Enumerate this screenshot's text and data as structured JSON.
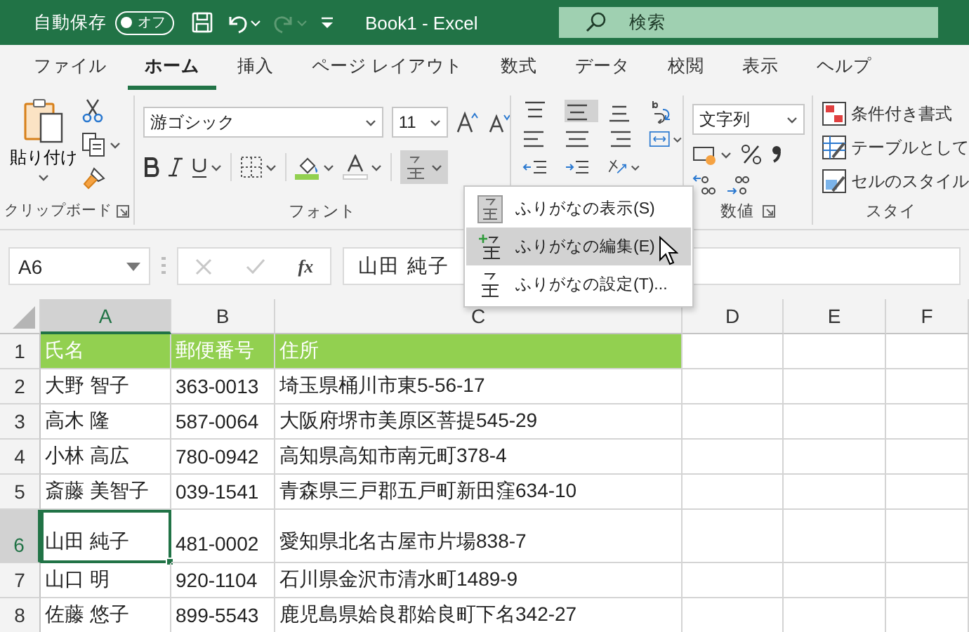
{
  "title_bar": {
    "autosave_label": "自動保存",
    "autosave": {
      "label": "オフ",
      "on": false
    },
    "title": "Book1  -  Excel",
    "search": {
      "placeholder": "検索"
    }
  },
  "ribbon_tabs": [
    {
      "label": "ファイル",
      "selected": false
    },
    {
      "label": "ホーム",
      "selected": true
    },
    {
      "label": "挿入",
      "selected": false
    },
    {
      "label": "ページ レイアウト",
      "selected": false
    },
    {
      "label": "数式",
      "selected": false
    },
    {
      "label": "データ",
      "selected": false
    },
    {
      "label": "校閲",
      "selected": false
    },
    {
      "label": "表示",
      "selected": false
    },
    {
      "label": "ヘルプ",
      "selected": false
    }
  ],
  "ribbon": {
    "clipboard": {
      "label": "クリップボード",
      "paste_label": "貼り付け"
    },
    "font": {
      "label": "フォント",
      "font_name": "游ゴシック",
      "font_size": "11"
    },
    "number": {
      "label": "数値",
      "format": "文字列"
    },
    "styles": {
      "label": "スタイ",
      "items": [
        "条件付き書式",
        "テーブルとして",
        "セルのスタイル"
      ]
    }
  },
  "furigana_menu": {
    "items": [
      {
        "label": "ふりがなの表示(S)",
        "selected": false
      },
      {
        "label": "ふりがなの編集(E)",
        "selected": true
      },
      {
        "label": "ふりがなの設定(T)...",
        "selected": false
      }
    ]
  },
  "formula_bar": {
    "name_box": "A6",
    "fx_label": "fx",
    "formula": "山田 純子"
  },
  "grid": {
    "columns": [
      {
        "label": "A",
        "selected": true
      },
      {
        "label": "B",
        "selected": false
      },
      {
        "label": "C",
        "selected": false
      },
      {
        "label": "D",
        "selected": false
      },
      {
        "label": "E",
        "selected": false
      },
      {
        "label": "F",
        "selected": false
      }
    ],
    "rows": [
      {
        "number": "1",
        "kind": "header",
        "selected": false,
        "furigana_shown": false,
        "cells": [
          "氏名",
          "郵便番号",
          "住所"
        ]
      },
      {
        "number": "2",
        "kind": "data",
        "selected": false,
        "furigana_shown": false,
        "cells": [
          "大野 智子",
          "363-0013",
          "埼玉県桶川市東5-56-17"
        ]
      },
      {
        "number": "3",
        "kind": "data",
        "selected": false,
        "furigana_shown": false,
        "cells": [
          "高木 隆",
          "587-0064",
          "大阪府堺市美原区菩提545-29"
        ]
      },
      {
        "number": "4",
        "kind": "data",
        "selected": false,
        "furigana_shown": false,
        "cells": [
          "小林 高広",
          "780-0942",
          "高知県高知市南元町378-4"
        ]
      },
      {
        "number": "5",
        "kind": "data",
        "selected": false,
        "furigana_shown": false,
        "cells": [
          "斎藤 美智子",
          "039-1541",
          "青森県三戸郡五戸町新田窪634-10"
        ]
      },
      {
        "number": "6",
        "kind": "data",
        "selected": true,
        "furigana_shown": true,
        "cells": [
          "山田 純子",
          "481-0002",
          "愛知県北名古屋市片場838-7"
        ]
      },
      {
        "number": "7",
        "kind": "data",
        "selected": false,
        "furigana_shown": false,
        "cells": [
          "山口 明",
          "920-1104",
          "石川県金沢市清水町1489-9"
        ]
      },
      {
        "number": "8",
        "kind": "data",
        "selected": false,
        "furigana_shown": false,
        "cells": [
          "佐藤 悠子",
          "899-5543",
          "鹿児島県姶良郡姶良町下名342-27"
        ]
      }
    ]
  }
}
